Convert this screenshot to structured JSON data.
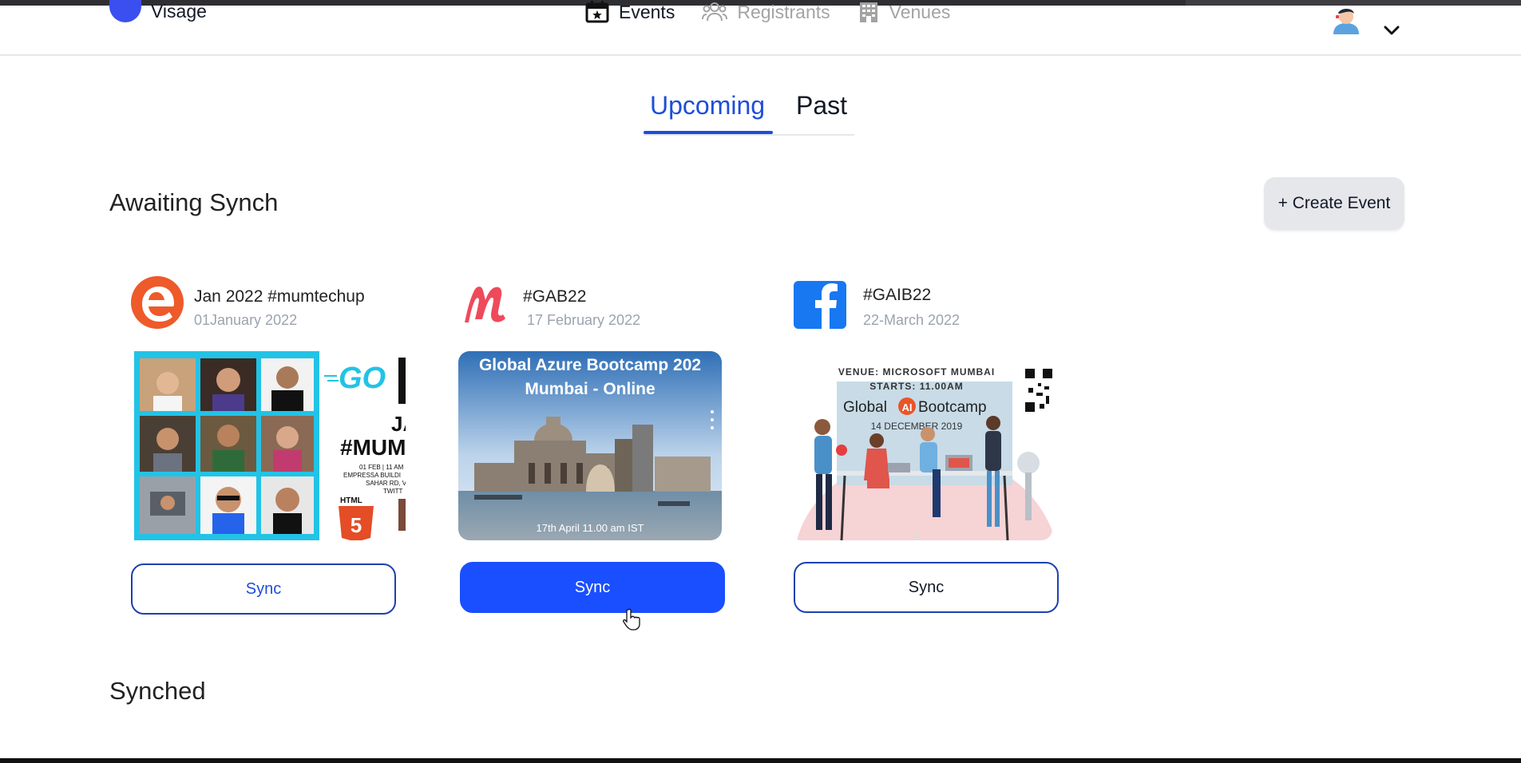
{
  "app": {
    "name": "Visage"
  },
  "nav": {
    "items": [
      {
        "label": "Events",
        "icon": "calendar-star-icon",
        "active": true
      },
      {
        "label": "Registrants",
        "icon": "users-icon",
        "active": false
      },
      {
        "label": "Venues",
        "icon": "building-icon",
        "active": false
      }
    ]
  },
  "tabs": {
    "upcoming": "Upcoming",
    "past": "Past"
  },
  "awaiting": {
    "title": "Awaiting Synch",
    "create_label": "+ Create Event",
    "cards": [
      {
        "name": "Jan 2022 #mumtechup",
        "date": "01January 2022",
        "source_icon": "eventbrite-icon",
        "sync_label": "Sync",
        "thumb": {
          "go": "GO",
          "line1": "JAN",
          "line2": "#MUM",
          "small1": "01 FEB | 11 AM",
          "small2": "EMPRESSA BUILDI",
          "small3": "SAHAR RD, V",
          "small4": "TWITT",
          "html": "HTML",
          "html_num": "5"
        }
      },
      {
        "name": "#GAB22",
        "date": "17 February 2022",
        "source_icon": "meetup-icon",
        "sync_label": "Sync",
        "thumb": {
          "title1": "Global Azure Bootcamp 202",
          "title2": "Mumbai - Online",
          "footer": "17th April  11.00 am IST"
        }
      },
      {
        "name": "#GAIB22",
        "date": "22-March 2022",
        "source_icon": "facebook-icon",
        "sync_label": "Sync",
        "thumb": {
          "venue": "VENUE: MICROSOFT MUMBAI",
          "starts": "STARTS: 11.00AM",
          "brand_a": "Global",
          "brand_ai": "AI",
          "brand_b": "Bootcamp",
          "date": "14 DECEMBER 2019"
        }
      }
    ]
  },
  "synched": {
    "title": "Synched"
  },
  "colors": {
    "primary": "#1a4fff",
    "accent_blue": "#1d4ed8",
    "logo": "#3b4ff0"
  }
}
